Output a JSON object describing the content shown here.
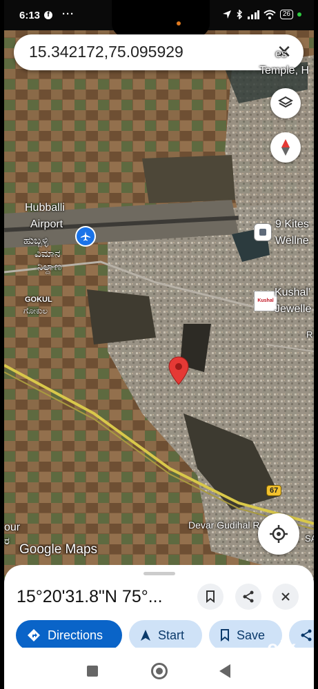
{
  "status_bar": {
    "time": "6:13",
    "battery": "26"
  },
  "search": {
    "query": "15.342172,75.095929"
  },
  "map_labels": {
    "airport_en_1": "Hubballi",
    "airport_en_2": "Airport",
    "airport_kn_1": "ಹುಬ್ಬಳ್ಳಿ",
    "airport_kn_2": "ವಿಮಾನ",
    "airport_kn_3": "ನಿಲ್ದಾಣ",
    "gokul_en": "GOKUL",
    "gokul_kn": "ಗೋಕುಲ",
    "kites_1": "9 Kites",
    "kites_2": "Wellne",
    "kushal_1": "Kushal'",
    "kushal_2": "Jewelle",
    "temple_1": "es",
    "temple_2": "Temple, H",
    "road_number": "67",
    "road_name": "Devar Gudihal Rd",
    "left_1": "our",
    "left_2": "ರ",
    "right_partial_1": "R",
    "right_partial_2": "SA",
    "kushal_logo": "Kushal"
  },
  "watermark": {
    "text": "Google Maps"
  },
  "bottom_sheet": {
    "coordinates": "15°20'31.8\"N 75°...",
    "actions": [
      {
        "label": "Directions",
        "icon": "directions-icon"
      },
      {
        "label": "Start",
        "icon": "navigation-arrow-icon"
      },
      {
        "label": "Save",
        "icon": "bookmark-icon"
      }
    ]
  },
  "overlay": {
    "olx": "olx"
  },
  "colors": {
    "primary": "#0a64c8",
    "secondary_chip": "#cfe2f7",
    "pin": "#e53935"
  }
}
